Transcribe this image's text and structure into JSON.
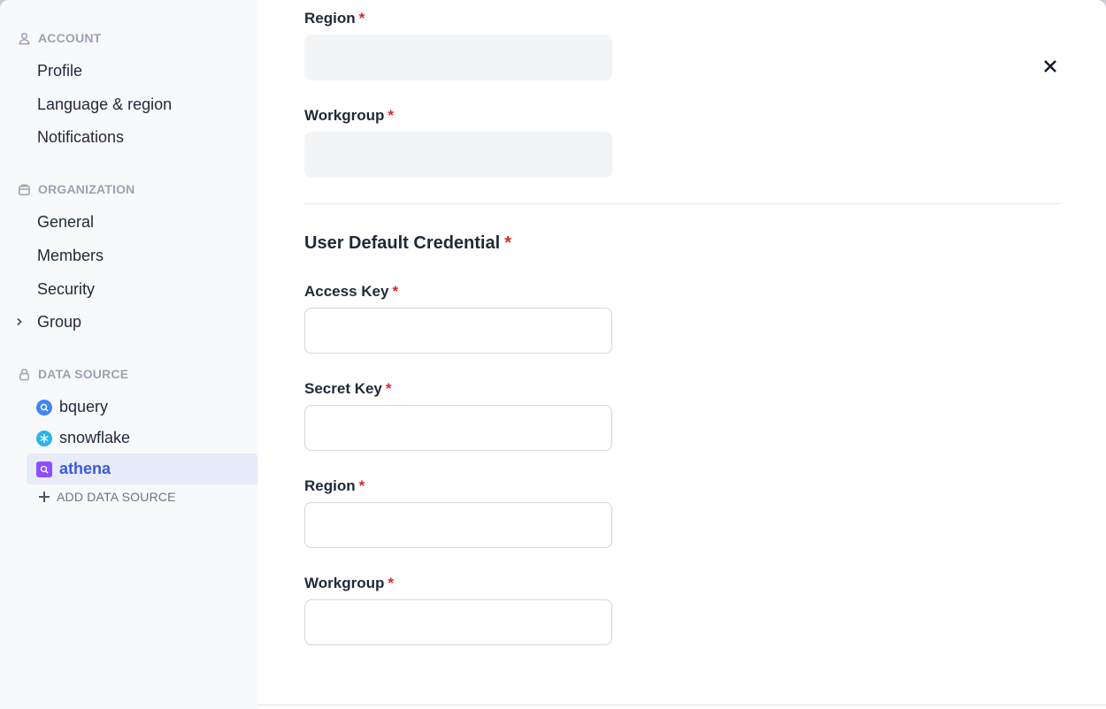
{
  "sidebar": {
    "account": {
      "header": "ACCOUNT",
      "items": [
        "Profile",
        "Language & region",
        "Notifications"
      ]
    },
    "organization": {
      "header": "ORGANIZATION",
      "items": [
        "General",
        "Members",
        "Security",
        "Group"
      ]
    },
    "data_source": {
      "header": "DATA SOURCE",
      "items": [
        "bquery",
        "snowflake",
        "athena"
      ],
      "active": "athena",
      "add_label": "ADD DATA SOURCE"
    }
  },
  "main": {
    "top_fields": {
      "region_label": "Region",
      "workgroup_label": "Workgroup"
    },
    "credential_section": {
      "title": "User Default Credential",
      "access_key_label": "Access Key",
      "secret_key_label": "Secret Key",
      "region_label": "Region",
      "workgroup_label": "Workgroup"
    },
    "required_mark": "*"
  },
  "colors": {
    "accent": "#3b5bdb",
    "required": "#dc2626",
    "sidebar_bg": "#f8f9fb",
    "active_bg": "#e8ebf8"
  }
}
